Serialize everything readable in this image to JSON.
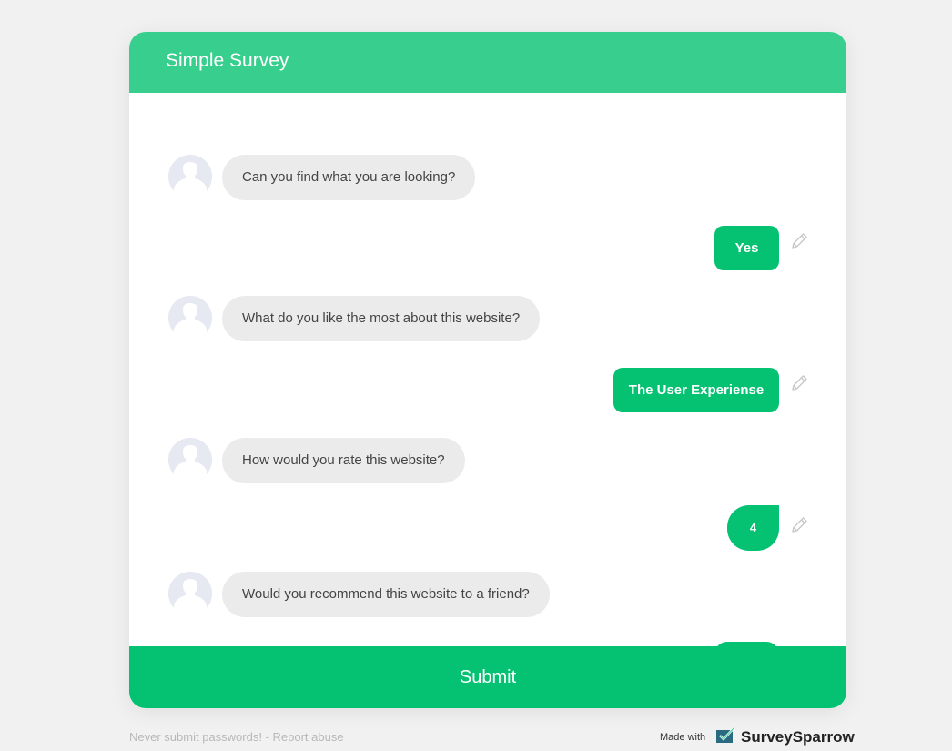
{
  "header": {
    "title": "Simple Survey"
  },
  "conversation": [
    {
      "question": "Can you find what you are looking?",
      "answer": "Yes"
    },
    {
      "question": "What do you like the most about this website?",
      "answer": "The User Experiense"
    },
    {
      "question": "How would you rate this website?",
      "answer": "4"
    },
    {
      "question": "Would you recommend this website to a friend?",
      "answer": ""
    }
  ],
  "icons": {
    "avatar": "person-avatar-icon",
    "edit": "pencil-icon",
    "brand": "surveysparrow-logo-icon"
  },
  "submit_label": "Submit",
  "footer": {
    "left_text": "Never submit passwords!",
    "separator": " - ",
    "report_abuse": "Report abuse",
    "made_with": "Made with",
    "brand": "SurveySparrow"
  },
  "colors": {
    "header": "#38cf8e",
    "accent": "#05c172",
    "question_bubble": "#ebebeb",
    "page_background": "#f1f1f1"
  }
}
